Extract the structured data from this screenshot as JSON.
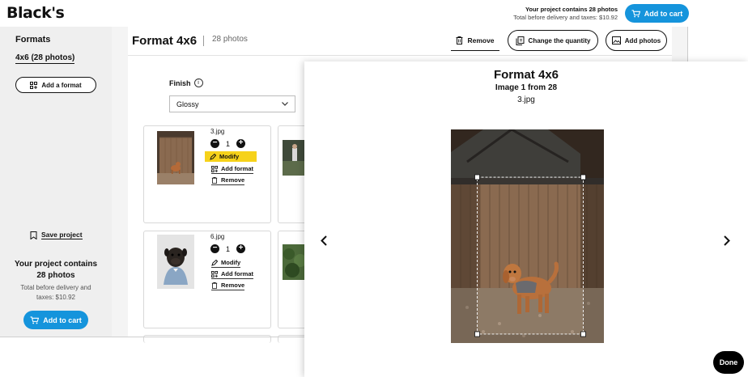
{
  "header": {
    "logo": "Black's",
    "summary_title": "Your project contains 28 photos",
    "summary_total": "Total before delivery and taxes: $10.92",
    "add_to_cart": "Add to cart"
  },
  "sidebar": {
    "title": "Formats",
    "selected_format": "4x6 (28 photos)",
    "add_format": "Add a format",
    "save_project": "Save project",
    "summary_title": "Your project contains 28 photos",
    "summary_total": "Total before delivery and taxes: $10.92",
    "add_to_cart": "Add to cart"
  },
  "main": {
    "title": "Format 4x6",
    "count": "28 photos",
    "toolbar": {
      "remove": "Remove",
      "change_quantity": "Change the quantity",
      "add_photos": "Add photos"
    },
    "finish_label": "Finish",
    "finish_value": "Glossy",
    "cards": [
      {
        "filename": "3.jpg",
        "quantity": "1",
        "modify": "Modify",
        "add_format": "Add format",
        "remove": "Remove"
      },
      {
        "filename": "6.jpg",
        "quantity": "1",
        "modify": "Modify",
        "add_format": "Add format",
        "remove": "Remove"
      }
    ]
  },
  "modal": {
    "title": "Format 4x6",
    "subtitle": "Image 1 from 28",
    "filename": "3.jpg",
    "done": "Done"
  },
  "colors": {
    "accent": "#1594dc",
    "highlight": "#f6d21a"
  }
}
